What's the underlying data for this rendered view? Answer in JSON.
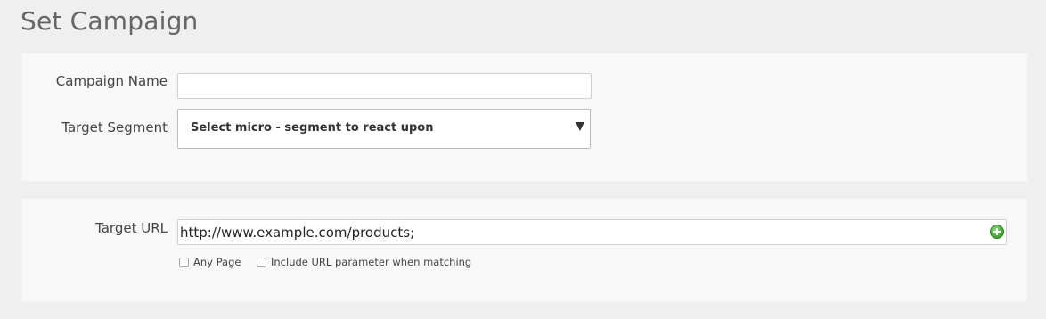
{
  "page": {
    "title": "Set Campaign"
  },
  "campaign": {
    "name_label": "Campaign Name",
    "name_value": "",
    "segment_label": "Target Segment",
    "segment_selected": "Select micro - segment to react upon"
  },
  "target_url": {
    "label": "Target URL",
    "value": "http://www.example.com/products;",
    "add_icon": "add-circle-icon",
    "options": [
      {
        "label": "Any Page",
        "checked": false
      },
      {
        "label": "Include URL parameter when matching",
        "checked": false
      }
    ]
  },
  "colors": {
    "background": "#efefef",
    "panel": "#f8f8f8",
    "add_icon_green": "#4cae3c"
  }
}
